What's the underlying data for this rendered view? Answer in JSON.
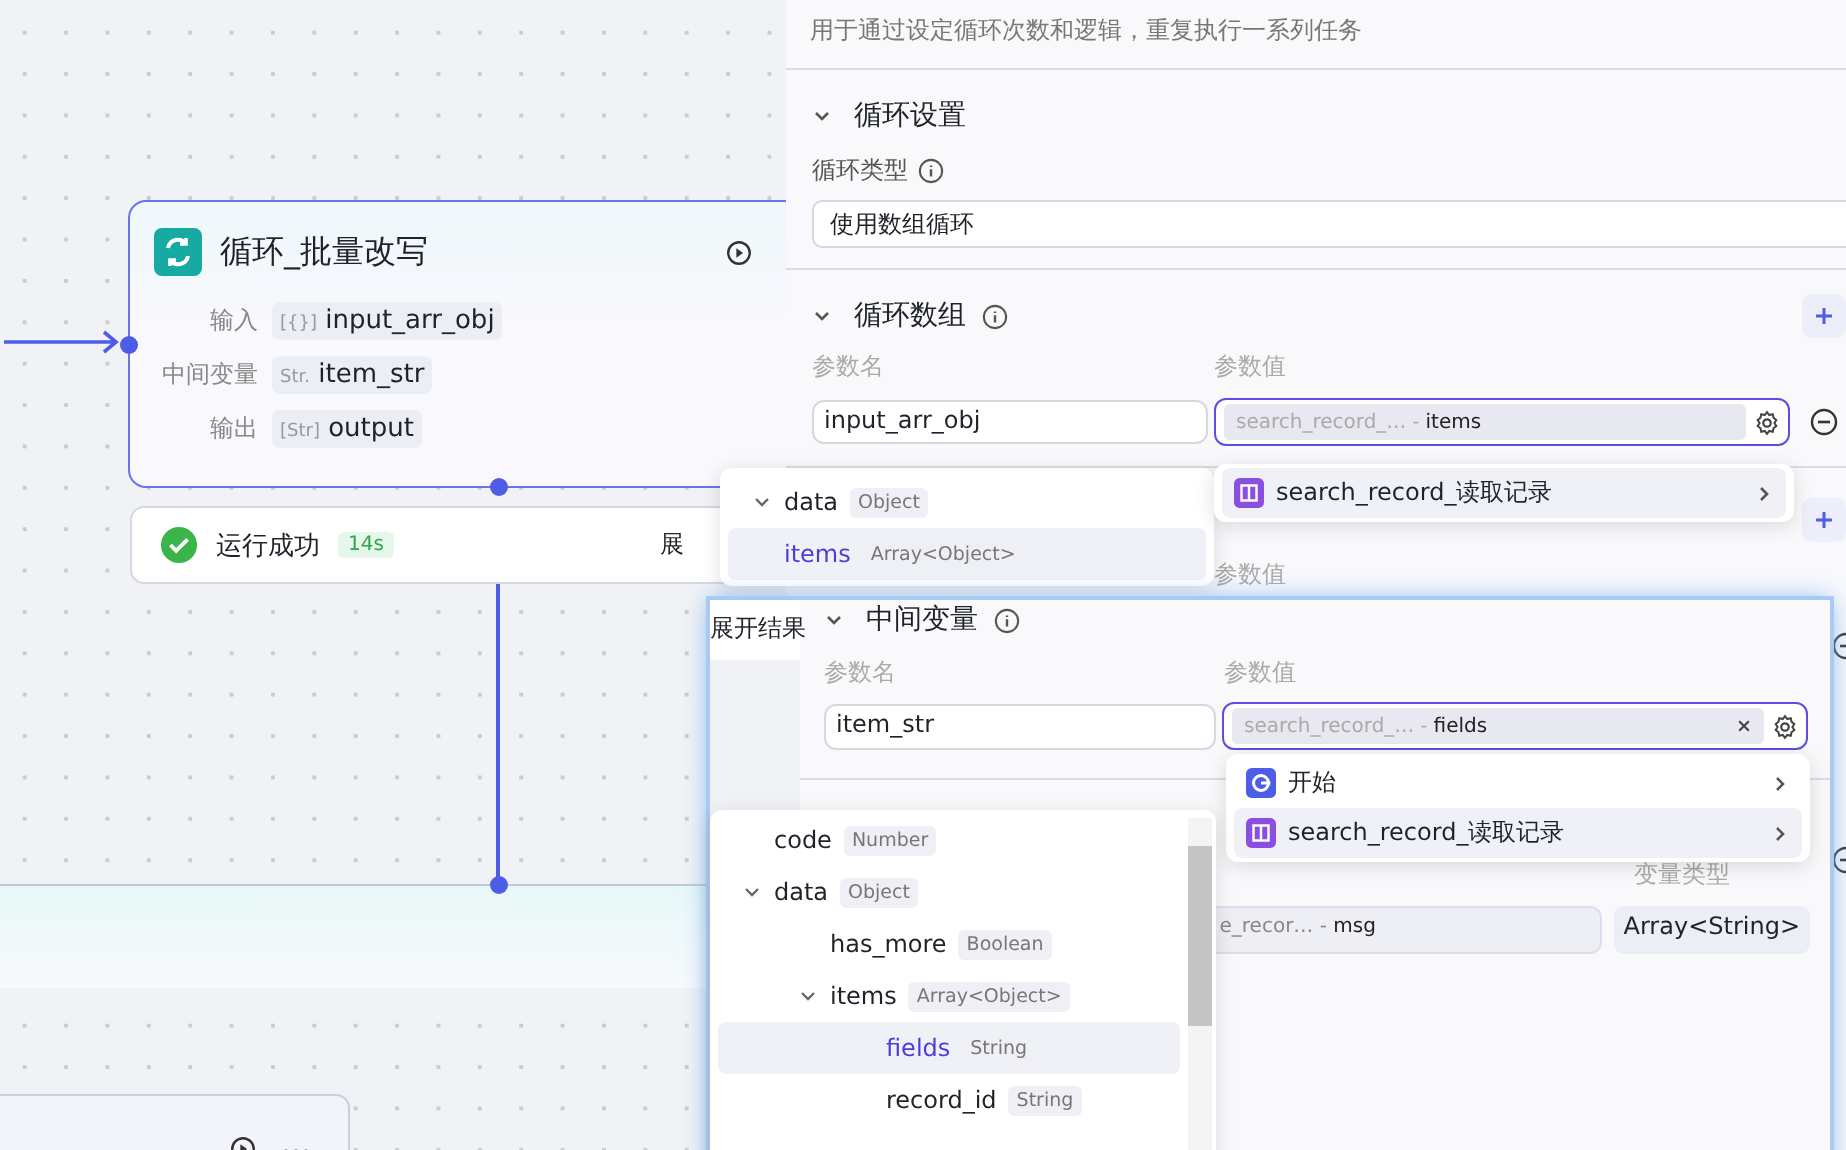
{
  "canvas": {
    "loop_node": {
      "title": "循环_批量改写",
      "params": [
        {
          "label": "输入",
          "type_tag": "[{}]",
          "value": "input_arr_obj"
        },
        {
          "label": "中间变量",
          "type_tag": "Str.",
          "value": "item_str"
        },
        {
          "label": "输出",
          "type_tag": "[Str]",
          "value": "output"
        }
      ]
    },
    "run_status": {
      "text": "运行成功",
      "duration": "14s",
      "link": "展"
    }
  },
  "settings_panel": {
    "description": "用于通过设定循环次数和逻辑，重复执行一系列任务",
    "loop_settings": {
      "title": "循环设置",
      "expanded": true,
      "type_label": "循环类型",
      "type_value": "使用数组循环"
    },
    "loop_array": {
      "title": "循环数组",
      "expanded": true,
      "name_header": "参数名",
      "value_header": "参数值",
      "row": {
        "name": "input_arr_obj",
        "source": "search_record_…",
        "separator": "-",
        "field": "items"
      }
    },
    "next_value_header": "参数值"
  },
  "array_source_tree": [
    {
      "name": "data",
      "type": "Object",
      "expanded": true,
      "selected": false
    },
    {
      "name": "items",
      "type": "Array<Object>",
      "selected": true
    }
  ],
  "array_source_menu": [
    {
      "kind": "record",
      "label": "search_record_读取记录",
      "selected": true
    }
  ],
  "var_panel": {
    "side_label": "展开结果",
    "title": "中间变量",
    "expanded": true,
    "name_header": "参数名",
    "value_header": "参数值",
    "row": {
      "name": "item_str",
      "source": "search_record_…",
      "separator": "-",
      "field": "fields"
    },
    "type_header": "变量类型",
    "output_row": {
      "source": "e_recor…",
      "separator": "-",
      "field": "msg",
      "type": "Array<String>"
    }
  },
  "var_source_menu": [
    {
      "kind": "start",
      "label": "开始",
      "selected": false
    },
    {
      "kind": "record",
      "label": "search_record_读取记录",
      "selected": true
    }
  ],
  "var_source_tree": [
    {
      "name": "code",
      "type": "Number",
      "selected": false
    },
    {
      "name": "data",
      "type": "Object",
      "expanded": true,
      "selected": false,
      "children": [
        {
          "name": "has_more",
          "type": "Boolean",
          "selected": false
        },
        {
          "name": "items",
          "type": "Array<Object>",
          "expanded": true,
          "selected": false,
          "children": [
            {
              "name": "fields",
              "type": "String",
              "selected": true
            },
            {
              "name": "record_id",
              "type": "String",
              "selected": false
            }
          ]
        }
      ]
    }
  ]
}
